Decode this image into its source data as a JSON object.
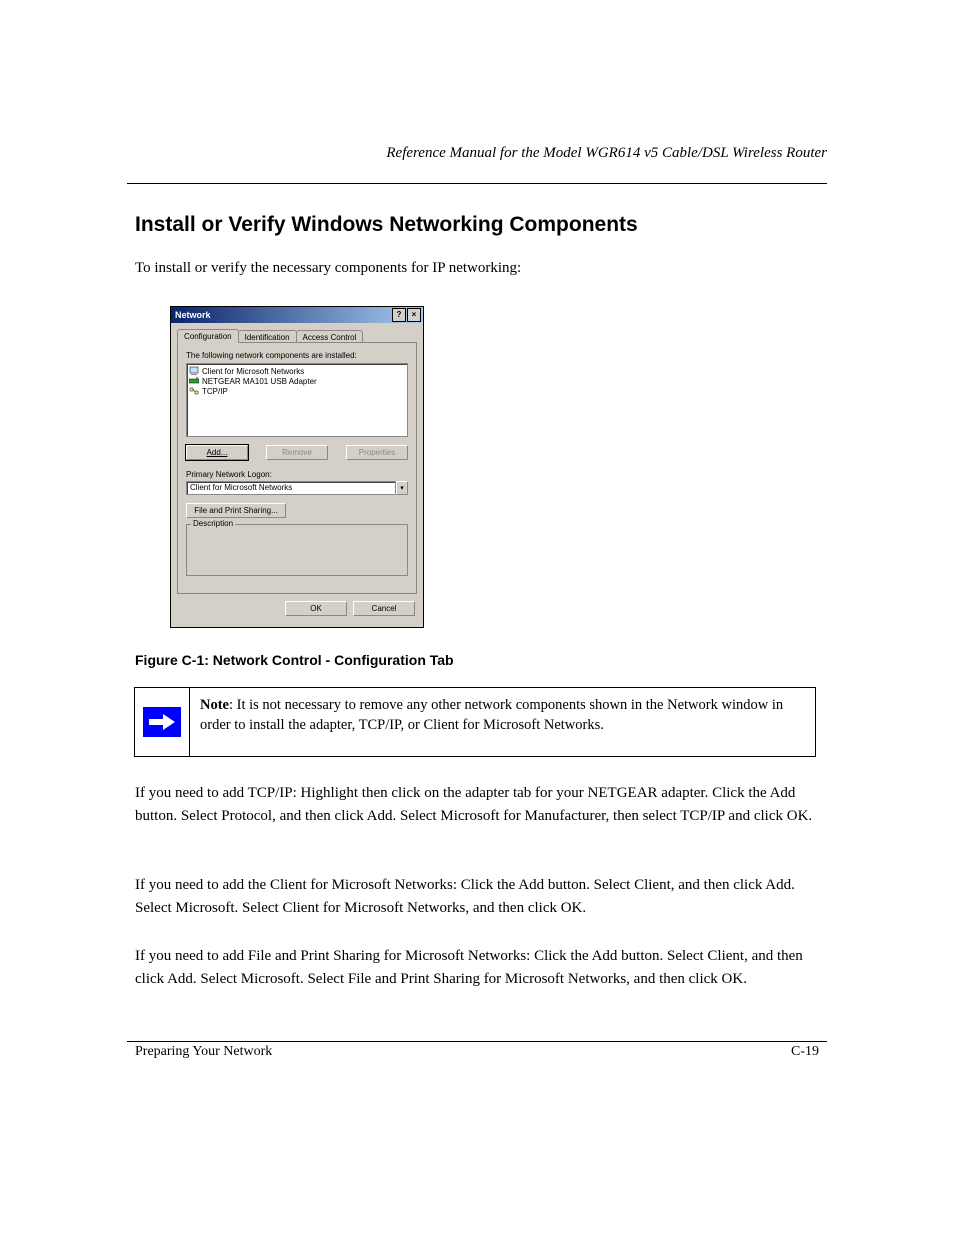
{
  "header": {
    "running": "Reference Manual for the Model WGR614 v5 Cable/DSL Wireless Router"
  },
  "section": {
    "title": "Install or Verify Windows Networking Components",
    "lead": "To install or verify the necessary components for IP networking:"
  },
  "dialog": {
    "title": "Network",
    "help_icon": "?",
    "close_icon": "×",
    "tabs": [
      "Configuration",
      "Identification",
      "Access Control"
    ],
    "components_label": "The following network components are installed:",
    "components": [
      {
        "name": "Client for Microsoft Networks",
        "icon": "client"
      },
      {
        "name": "NETGEAR MA101 USB Adapter",
        "icon": "adapter"
      },
      {
        "name": "TCP/IP",
        "icon": "protocol"
      }
    ],
    "buttons": {
      "add": "Add...",
      "remove": "Remove",
      "properties": "Properties"
    },
    "logon_label": "Primary Network Logon:",
    "logon_value": "Client for Microsoft Networks",
    "file_print": "File and Print Sharing...",
    "desc_legend": "Description",
    "ok": "OK",
    "cancel": "Cancel"
  },
  "figure": {
    "caption": "Figure C-1:  Network Control - Configuration Tab"
  },
  "note": {
    "label": "Note",
    "body": ": It is not necessary to remove any other network components shown in the Network window in order to install the adapter, TCP/IP, or Client for Microsoft Networks."
  },
  "body": {
    "p1": "If you need to add TCP/IP: Highlight then click on the adapter tab for your NETGEAR adapter. Click the Add button. Select Protocol, and then click Add. Select Microsoft for Manufacturer, then select TCP/IP and click OK.",
    "p2": "If you need to add the Client for Microsoft Networks: Click the Add button. Select Client, and then click Add. Select Microsoft. Select Client for Microsoft Networks, and then click OK.",
    "p3": "If you need to add File and Print Sharing for Microsoft Networks: Click the Add button. Select Client, and then click Add. Select Microsoft. Select File and Print Sharing for Microsoft Networks, and then click OK."
  },
  "footer": {
    "left": "Preparing Your Network",
    "right": "C-19"
  }
}
